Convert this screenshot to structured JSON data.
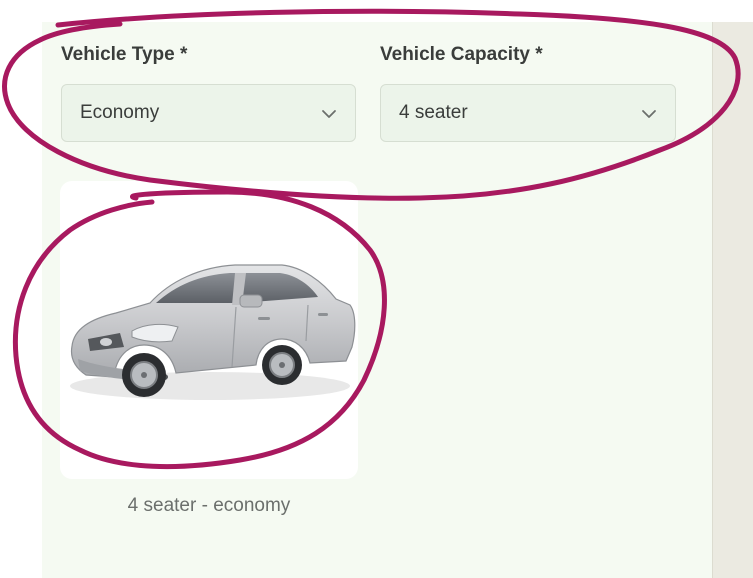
{
  "form": {
    "vehicle_type": {
      "label": "Vehicle Type *",
      "value": "Economy"
    },
    "vehicle_capacity": {
      "label": "Vehicle Capacity *",
      "value": "4 seater"
    }
  },
  "vehicle_option": {
    "caption": "4 seater - economy",
    "image": "sedan-car-image"
  },
  "colors": {
    "panel_background": "#f5faf2",
    "select_background": "#ecf4ea",
    "annotation_stroke": "#a8195f",
    "right_strip": "#ebeae1"
  }
}
